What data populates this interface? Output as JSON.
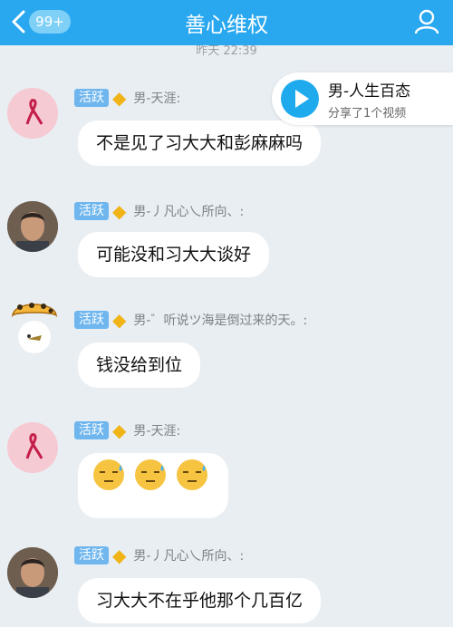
{
  "header": {
    "unread_badge": "99+",
    "title": "善心维权"
  },
  "timestamp": "昨天 22:39",
  "banner": {
    "title": "男-人生百态",
    "subtitle": "分享了1个视频"
  },
  "level_tag": "活跃",
  "messages": [
    {
      "nickname": "男-天涯:",
      "text": "不是见了习大大和彭麻麻吗"
    },
    {
      "nickname": "男-丿凡心乀所向、:",
      "text": "可能没和习大大谈好"
    },
    {
      "nickname": "男-゛听说ツ海是倒过来的天。:",
      "text": "钱没给到位"
    },
    {
      "nickname": "男-天涯:",
      "text": ""
    },
    {
      "nickname": "男-丿凡心乀所向、:",
      "text": "习大大不在乎他那个几百亿"
    }
  ],
  "colors": {
    "header": "#29a8f0",
    "background": "#e9eef2",
    "level_tag": "#6fb6ee"
  }
}
